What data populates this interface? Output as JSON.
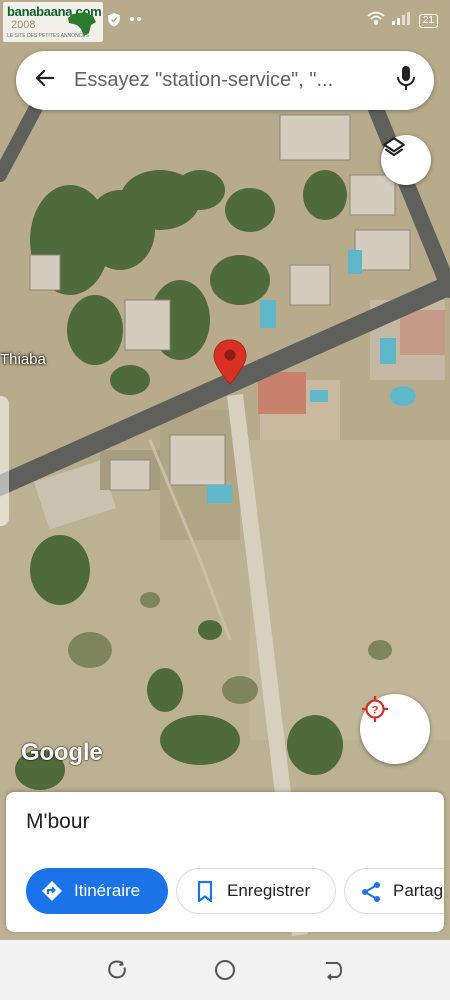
{
  "status_bar": {
    "watermark_name": "banabaana.com",
    "watermark_year": "2008",
    "watermark_tagline": "LE SITE DES PETITES ANNONCES",
    "battery": "21",
    "icons": [
      "watermark-logo",
      "shield-icon",
      "dots-icon",
      "wifi-icon",
      "signal-icon",
      "battery-icon"
    ]
  },
  "search": {
    "placeholder": "Essayez \"station-service\", \"...",
    "back_icon": "arrow-left-icon",
    "mic_icon": "mic-icon"
  },
  "map": {
    "place_label": "Thiaba",
    "attribution": "Google",
    "pin_icon": "map-pin-icon",
    "layers_icon": "layers-icon",
    "location_icon": "my-location-icon"
  },
  "place": {
    "title": "M'bour",
    "actions": [
      {
        "label": "Itinéraire",
        "icon": "directions-icon"
      },
      {
        "label": "Enregistrer",
        "icon": "bookmark-icon"
      },
      {
        "label": "Partag",
        "icon": "share-icon"
      }
    ]
  },
  "nav": {
    "buttons": [
      "recents-icon",
      "home-icon",
      "back-icon"
    ]
  },
  "colors": {
    "accent": "#1a73e8",
    "pin": "#d93025",
    "location": "#d93025",
    "road": "#5e5f5b",
    "ground": "#b9ad8f"
  }
}
